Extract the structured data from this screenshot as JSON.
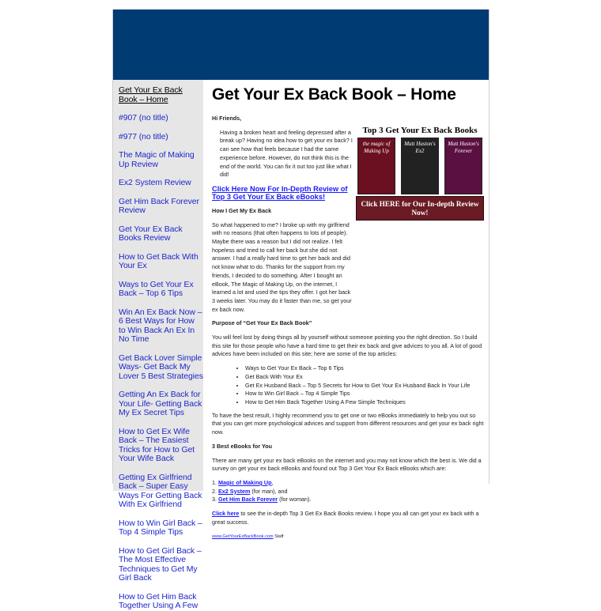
{
  "sidebar": {
    "items": [
      {
        "label": "Get Your Ex Back Book – Home"
      },
      {
        "label": "#907 (no title)"
      },
      {
        "label": "#977 (no title)"
      },
      {
        "label": "The Magic of Making Up Review"
      },
      {
        "label": "Ex2 System Review"
      },
      {
        "label": "Get Him Back Forever Review"
      },
      {
        "label": "Get Your Ex Back Books Review"
      },
      {
        "label": "How to Get Back With Your Ex"
      },
      {
        "label": "Ways to Get Your Ex Back – Top 6 Tips"
      },
      {
        "label": "Win An Ex Back Now – 6 Best Ways for How to Win Back An Ex In No Time"
      },
      {
        "label": "Get Back Lover Simple Ways- Get Back My Lover 5 Best Strategies"
      },
      {
        "label": "Getting An Ex Back for Your Life- Getting Back My Ex Secret Tips"
      },
      {
        "label": "How to Get Ex Wife Back – The Easiest Tricks for How to Get Your Wife Back"
      },
      {
        "label": "Getting Ex Girlfriend Back – Super Easy Ways For Getting Back With Ex Girlfriend"
      },
      {
        "label": "How to Win Girl Back – Top 4 Simple Tips"
      },
      {
        "label": "How to Get Girl Back – The Most Effective Techniques to Get My Girl Back"
      },
      {
        "label": "How to Get Him Back Together Using A Few"
      }
    ]
  },
  "main": {
    "title": "Get Your Ex Back Book – Home",
    "greeting": "Hi Friends,",
    "intro": "Having a broken heart and feeling depressed after a break up? Having no idea how to get your ex back? I can see how that feels because I had the same experience before. However, do not think this is the end of the world. You can fix it out too just like what I did!",
    "ad": {
      "title": "Top 3 Get Your Ex Back Books",
      "book1": "the magic of Making Up",
      "book2": "Matt Huston's Ex2",
      "book3": "Matt Huston's Forever",
      "button": "Click HERE for Our In-depth Review Now!"
    },
    "cta": "Click Here Now For In-Depth Review of Top 3 Get Your Ex Back eBooks!",
    "how_heading": "How I Get My Ex Back",
    "how_text": "So what happened to me? I broke up with my girlfriend with no reasons (that often happens to lots of people). Maybe there was a reason but I did not realize. I felt hopeless and tried to call her back but she did not answer. I had a really hard time to get her back and did not know what to do. Thanks for the support from my friends, I decided to do something. After I bought an eBook, The Magic of Making Up, on the internet, I learned a lot and used the tips they offer. I got her back 3 weeks later. You may do it faster than me, so get your ex back now.",
    "purpose_heading": "Purpose of “Get Your Ex Back Book”",
    "purpose_text": "You will feel lost by doing things all by yourself without someone pointing you the right direction. So I build this site for those people who have a hard time to get their ex back and give advices to you all. A lot of good advices have been included on this site; here are some of the top articles:",
    "articles": [
      "Ways to Get Your Ex Back – Top 6 Tips",
      "Get Back With Your Ex",
      "Get Ex Husband Back – Top 5 Secrets for How to Get Your Ex Husband Back In Your Life",
      "How to Win Girl Back – Top 4 Simple Tips",
      "How to Get Him Back Together Using A Few Simple Techniques"
    ],
    "result_text": "To have the best result, I highly recommend you to get one or two eBooks immediately to help you out so that you can get more psychological advices and support from different resources and get your ex back right now.",
    "best_heading": "3 Best eBooks for You",
    "best_text": "There are many get your ex back eBooks on the internet and you may not know which the best is. We did a survey on get your ex back eBooks and found out Top 3 Get Your Ex Back eBooks which are:",
    "ebooks": [
      {
        "num": "1.",
        "name": "Magic of Making Up",
        "note": ","
      },
      {
        "num": "2.",
        "name": "Ex2 System",
        "note": " (for man), and"
      },
      {
        "num": "3.",
        "name": "Get Him Back Forever",
        "note": " (for woman)."
      }
    ],
    "click_here": "Click here",
    "click_rest": " to see the in-depth Top 3 Get Ex Back Books review. I hope you all can get your ex back with a great success.",
    "footer_link": "www.GetYourExBackBook.com",
    "footer_rest": " Staff"
  }
}
